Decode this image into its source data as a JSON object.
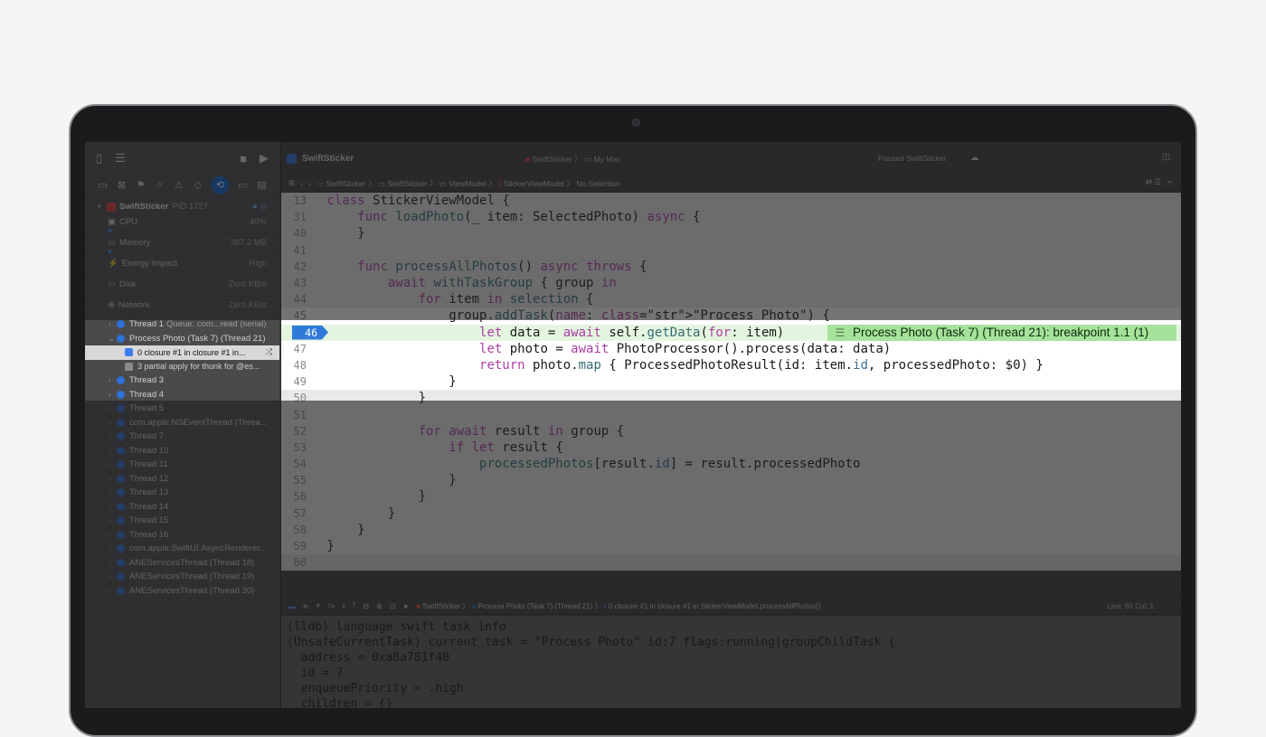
{
  "sidebar": {
    "process": {
      "name": "SwiftSticker",
      "pid": "PID 1727"
    },
    "gauges": [
      {
        "label": "CPU",
        "value": "40%"
      },
      {
        "label": "Memory",
        "value": "387.2 MB"
      },
      {
        "label": "Energy Impact",
        "value": "High"
      },
      {
        "label": "Disk",
        "value": "Zero KB/s"
      },
      {
        "label": "Network",
        "value": "Zero KB/s"
      }
    ],
    "thread1": {
      "name": "Thread 1",
      "queue": "Queue: com...read (serial)"
    },
    "task": "Process Photo (Task 7) (Thread 21)",
    "frames": [
      "0 closure #1 in closure #1 in...",
      "3 partial apply for thunk for @es..."
    ],
    "threads": [
      "Thread 3",
      "Thread 4",
      "Thread 5",
      "com.apple.NSEventThread (Threa...",
      "Thread 7",
      "Thread 10",
      "Thread 11",
      "Thread 12",
      "Thread 13",
      "Thread 14",
      "Thread 15",
      "Thread 16",
      "com.apple.SwiftUI.AsyncRenderer...",
      "ANEServicesThread (Thread 18)",
      "ANEServicesThread (Thread 19)",
      "ANEServicesThread (Thread 20)"
    ]
  },
  "titlebar": {
    "app": "SwiftSticker",
    "scheme": "SwiftSticker",
    "destination": "My Mac",
    "status": "Paused SwiftSticker"
  },
  "jumpbar": {
    "crumbs": [
      "SwiftSticker",
      "SwiftSticker",
      "ViewModel",
      "StickerViewModel",
      "No Selection"
    ]
  },
  "code": {
    "lines": [
      {
        "n": "13",
        "t": "class StickerViewModel {"
      },
      {
        "n": "31",
        "t": "    func loadPhoto(_ item: SelectedPhoto) async {"
      },
      {
        "n": "40",
        "t": "    }"
      },
      {
        "n": "41",
        "t": ""
      },
      {
        "n": "42",
        "t": "    func processAllPhotos() async throws {"
      },
      {
        "n": "43",
        "t": "        await withTaskGroup { group in"
      },
      {
        "n": "44",
        "t": "            for item in selection {"
      },
      {
        "n": "45",
        "t": "                group.addTask(name: \"Process Photo\") {"
      },
      {
        "n": "46",
        "t": "                    let data = await self.getData(for: item)"
      },
      {
        "n": "47",
        "t": "                    let photo = await PhotoProcessor().process(data: data)"
      },
      {
        "n": "48",
        "t": "                    return photo.map { ProcessedPhotoResult(id: item.id, processedPhoto: $0) }"
      },
      {
        "n": "49",
        "t": "                }"
      },
      {
        "n": "50",
        "t": "            }"
      },
      {
        "n": "51",
        "t": ""
      },
      {
        "n": "52",
        "t": "            for await result in group {"
      },
      {
        "n": "53",
        "t": "                if let result {"
      },
      {
        "n": "54",
        "t": "                    processedPhotos[result.id] = result.processedPhoto"
      },
      {
        "n": "55",
        "t": "                }"
      },
      {
        "n": "56",
        "t": "            }"
      },
      {
        "n": "57",
        "t": "        }"
      },
      {
        "n": "58",
        "t": "    }"
      },
      {
        "n": "59",
        "t": "}"
      },
      {
        "n": "60",
        "t": ""
      }
    ],
    "breakpoint_line": "46",
    "breakpoint_label": "Process Photo (Task 7) (Thread 21): breakpoint 1.1 (1)"
  },
  "debugbar": {
    "crumbs": [
      "SwiftSticker",
      "Process Photo (Task 7) (Thread 21)",
      "0 closure #1 in closure #1 in StickerViewModel.processAllPhotos()"
    ],
    "position": "Line: 60  Col: 1"
  },
  "console": {
    "lines": [
      "(lldb) language swift task info",
      "(UnsafeCurrentTask) current_task = \"Process Photo\" id:7 flags:running|groupChildTask {",
      "  address = 0xa8a781f40",
      "  id = 7",
      "  enqueuePriority = .high",
      "  children = {}"
    ]
  }
}
